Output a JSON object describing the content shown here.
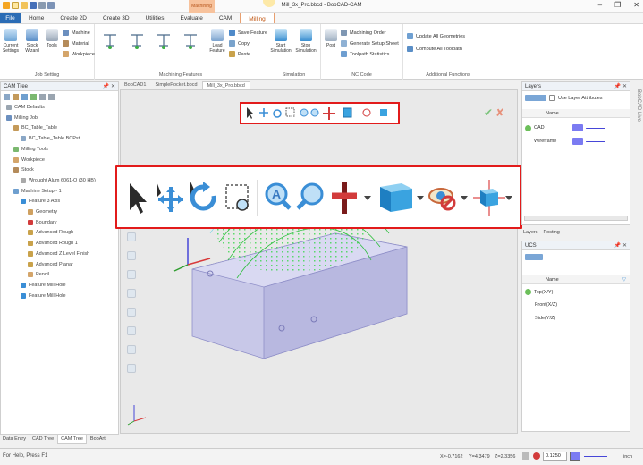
{
  "window": {
    "title": "Mill_3x_Pro.bbcd - BobCAD-CAM",
    "context_tab": "Machining"
  },
  "tabs": [
    "File",
    "Home",
    "Create 2D",
    "Create 3D",
    "Utilities",
    "Evaluate",
    "CAM",
    "Milling"
  ],
  "ribbon": {
    "job_setting": {
      "label": "Job Setting",
      "current_settings": "Current Settings",
      "stock_wizard": "Stock Wizard",
      "tools": "Tools",
      "machine": "Machine",
      "material": "Material",
      "workpiece": "Workpiece"
    },
    "machining_features": {
      "label": "Machining Features",
      "load_feature": "Load Feature",
      "save_feature": "Save Feature",
      "copy": "Copy",
      "paste": "Paste"
    },
    "simulation": {
      "label": "Simulation",
      "start": "Start Simulation",
      "stop": "Stop Simulation"
    },
    "nc_code": {
      "label": "NC Code",
      "post": "Post",
      "machining_order": "Machining Order",
      "generate_setup_sheet": "Generate Setup Sheet",
      "toolpath_statistics": "Toolpath Statistics"
    },
    "additional": {
      "label": "Additional Functions",
      "update_all": "Update All Geometries",
      "compute_all": "Compute All Toolpath"
    }
  },
  "cam_tree": {
    "title": "CAM Tree",
    "items": [
      {
        "label": "CAM Defaults",
        "level": 0
      },
      {
        "label": "Milling Job",
        "level": 0
      },
      {
        "label": "BC_Table_Table",
        "level": 1
      },
      {
        "label": "BC_Table_Table.BCPst",
        "level": 2
      },
      {
        "label": "Milling Tools",
        "level": 1
      },
      {
        "label": "Workpiece",
        "level": 1
      },
      {
        "label": "Stock",
        "level": 1
      },
      {
        "label": "Wrought Alum 6061-O (30 HB)",
        "level": 2
      },
      {
        "label": "Machine Setup - 1",
        "level": 1
      },
      {
        "label": "Feature 3 Axis",
        "level": 2
      },
      {
        "label": "Geometry",
        "level": 3
      },
      {
        "label": "Boundary",
        "level": 3
      },
      {
        "label": "Advanced Rough",
        "level": 3
      },
      {
        "label": "Advanced Rough 1",
        "level": 3
      },
      {
        "label": "Advanced Z Level Finish",
        "level": 3
      },
      {
        "label": "Advanced Planar",
        "level": 3
      },
      {
        "label": "Pencil",
        "level": 3
      },
      {
        "label": "Feature Mill Hole",
        "level": 2
      },
      {
        "label": "Feature Mill Hole",
        "level": 2
      }
    ]
  },
  "bottom_tabs": [
    "Data Entry",
    "CAD Tree",
    "CAM Tree",
    "BobArt"
  ],
  "doc_tabs": [
    "BobCAD1",
    "SimplePocket.bbcd",
    "Mill_3x_Pro.bbcd"
  ],
  "layers": {
    "title": "Layers",
    "use_layer_attributes": "Use Layer Attributes",
    "col_name": "Name",
    "rows": [
      {
        "name": "CAD",
        "color": "#7b7bf2"
      },
      {
        "name": "Wireframe",
        "color": "#7b7bf2"
      }
    ],
    "tabs": [
      "Layers",
      "Posting"
    ]
  },
  "ucs": {
    "title": "UCS",
    "col_name": "Name",
    "rows": [
      "Top(X/Y)",
      "Front(X/Z)",
      "Side(Y/Z)"
    ]
  },
  "status": {
    "help": "For Help, Press F1",
    "x": "X=-0.7162",
    "y": "Y=4.3479",
    "z": "Z=2.3356",
    "value": "0.1250",
    "unit": "inch"
  },
  "side_label": "BobCAD Live"
}
